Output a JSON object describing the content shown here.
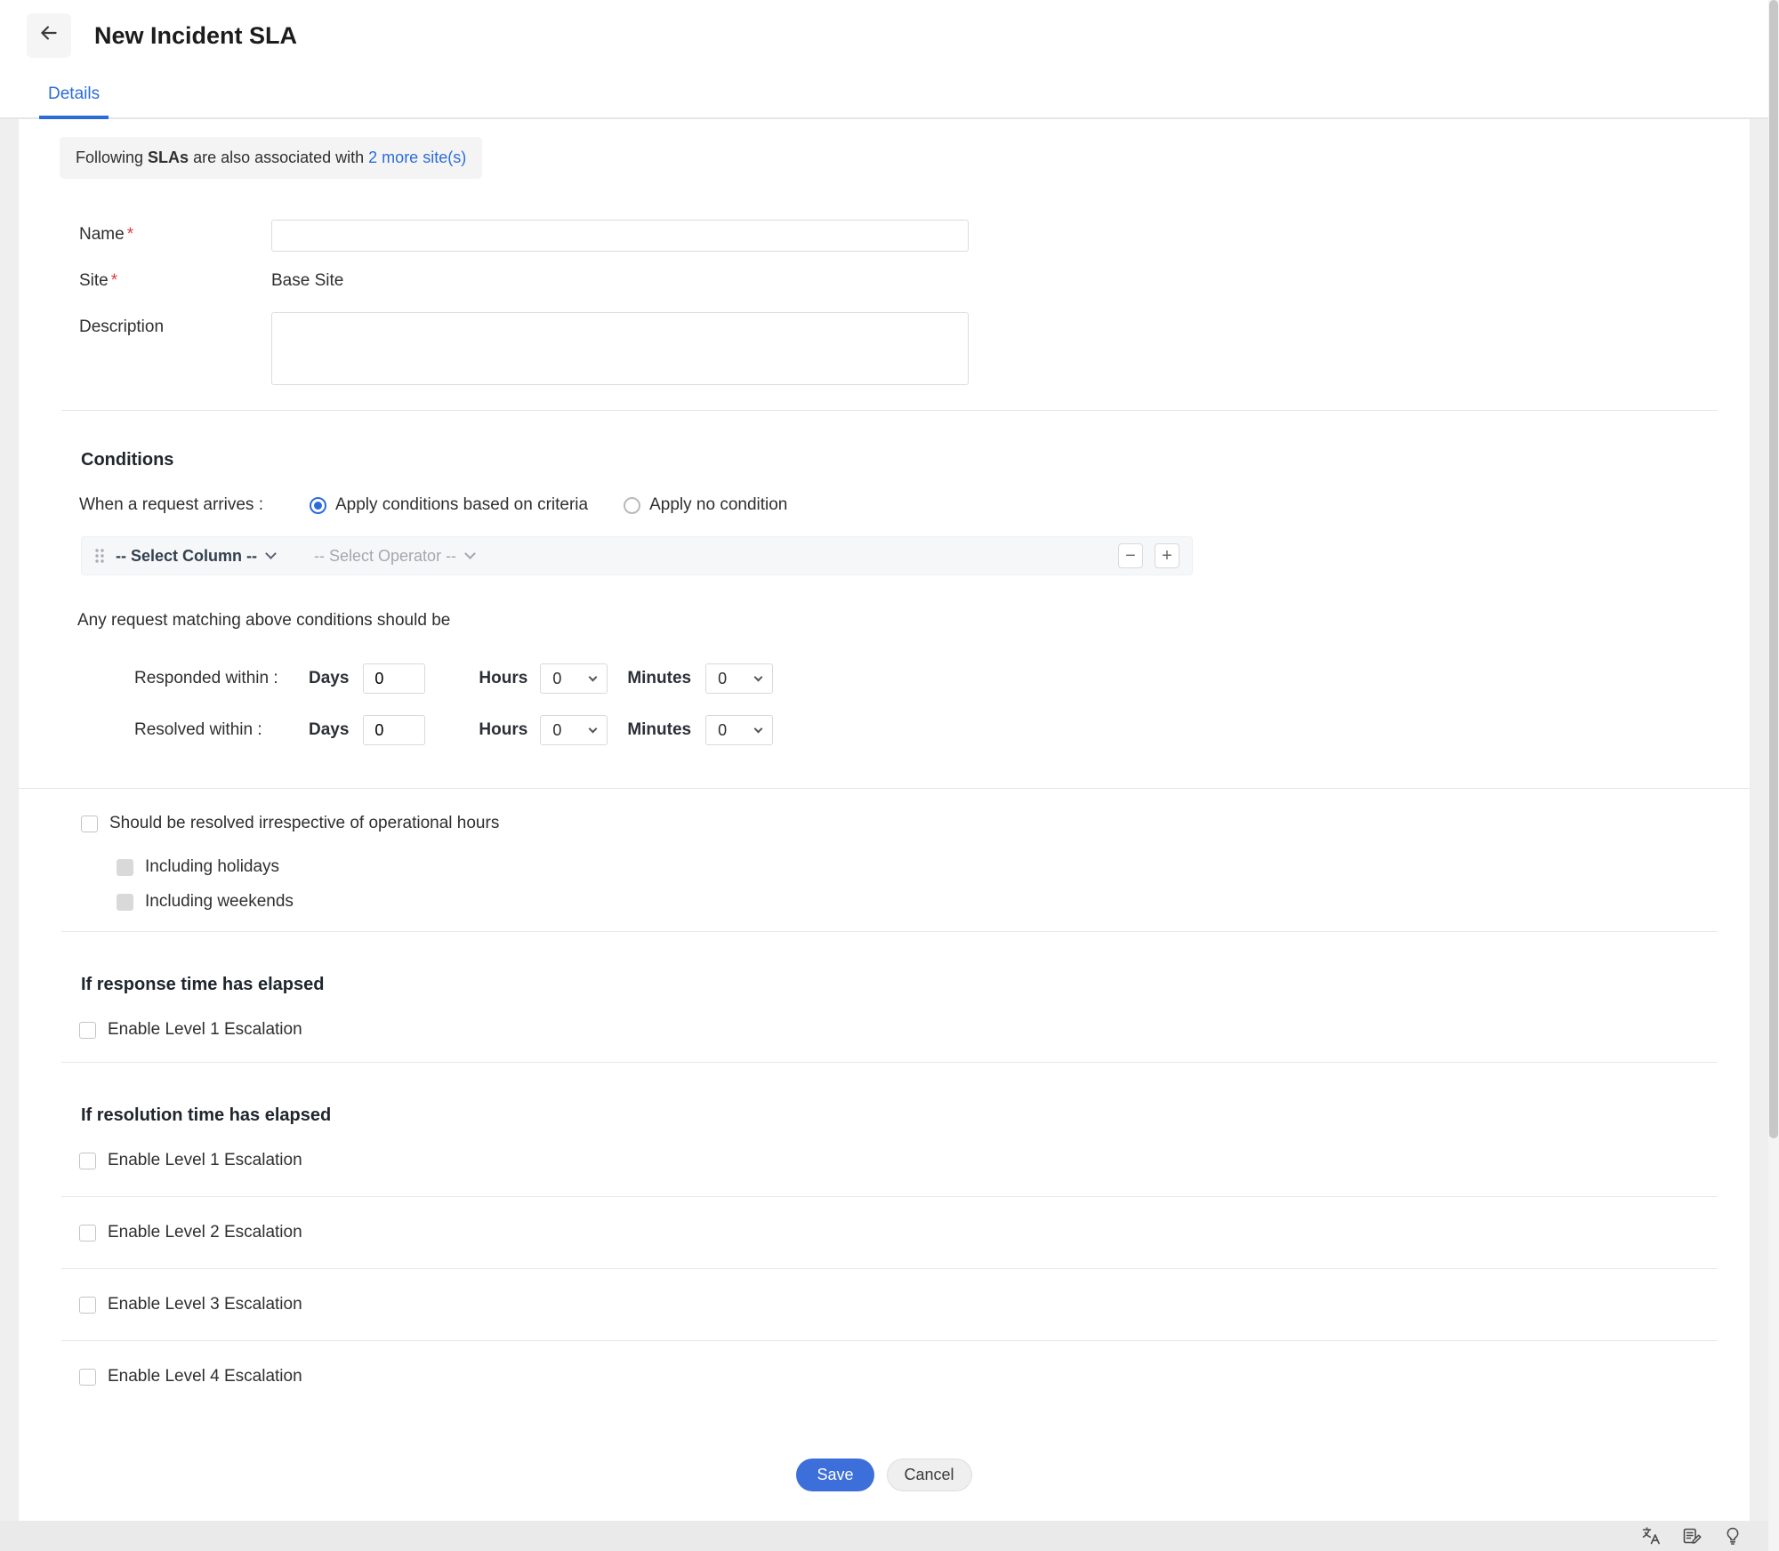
{
  "header": {
    "title": "New Incident SLA"
  },
  "tabs": {
    "details": "Details"
  },
  "banner": {
    "prefix": "Following ",
    "bold": "SLAs",
    "middle": " are also associated with ",
    "link": "2 more site(s)"
  },
  "form": {
    "required_marker": "*",
    "name_label": "Name",
    "name_value": "",
    "site_label": "Site",
    "site_value": "Base Site",
    "description_label": "Description",
    "description_value": ""
  },
  "conditions": {
    "heading": "Conditions",
    "arrives_label": "When a request arrives :",
    "radio_criteria": "Apply conditions based on criteria",
    "radio_none": "Apply no condition",
    "select_column": "-- Select Column --",
    "select_operator": "-- Select Operator --",
    "remove_label": "−",
    "add_label": "+",
    "matching_text": "Any request matching above conditions should be",
    "responded_label": "Responded within :",
    "resolved_label": "Resolved within :",
    "days_label": "Days",
    "hours_label": "Hours",
    "minutes_label": "Minutes",
    "responded": {
      "days": "0",
      "hours": "0",
      "minutes": "0"
    },
    "resolved": {
      "days": "0",
      "hours": "0",
      "minutes": "0"
    }
  },
  "operational": {
    "main_checkbox": "Should be resolved irrespective of operational hours",
    "holidays": "Including holidays",
    "weekends": "Including weekends"
  },
  "escalations": {
    "response_heading": "If response time has elapsed",
    "response_items": [
      "Enable Level 1 Escalation"
    ],
    "resolution_heading": "If resolution time has elapsed",
    "resolution_items": [
      "Enable Level 1 Escalation",
      "Enable Level 2 Escalation",
      "Enable Level 3 Escalation",
      "Enable Level 4 Escalation"
    ]
  },
  "actions": {
    "save": "Save",
    "cancel": "Cancel"
  },
  "footer": {
    "icons": [
      "translate-icon",
      "feedback-icon",
      "lightbulb-icon"
    ]
  },
  "colors": {
    "accent": "#2b6cd9",
    "link": "#2c6cd9",
    "required": "#e03b3b",
    "save_button": "#3d6fdb"
  }
}
